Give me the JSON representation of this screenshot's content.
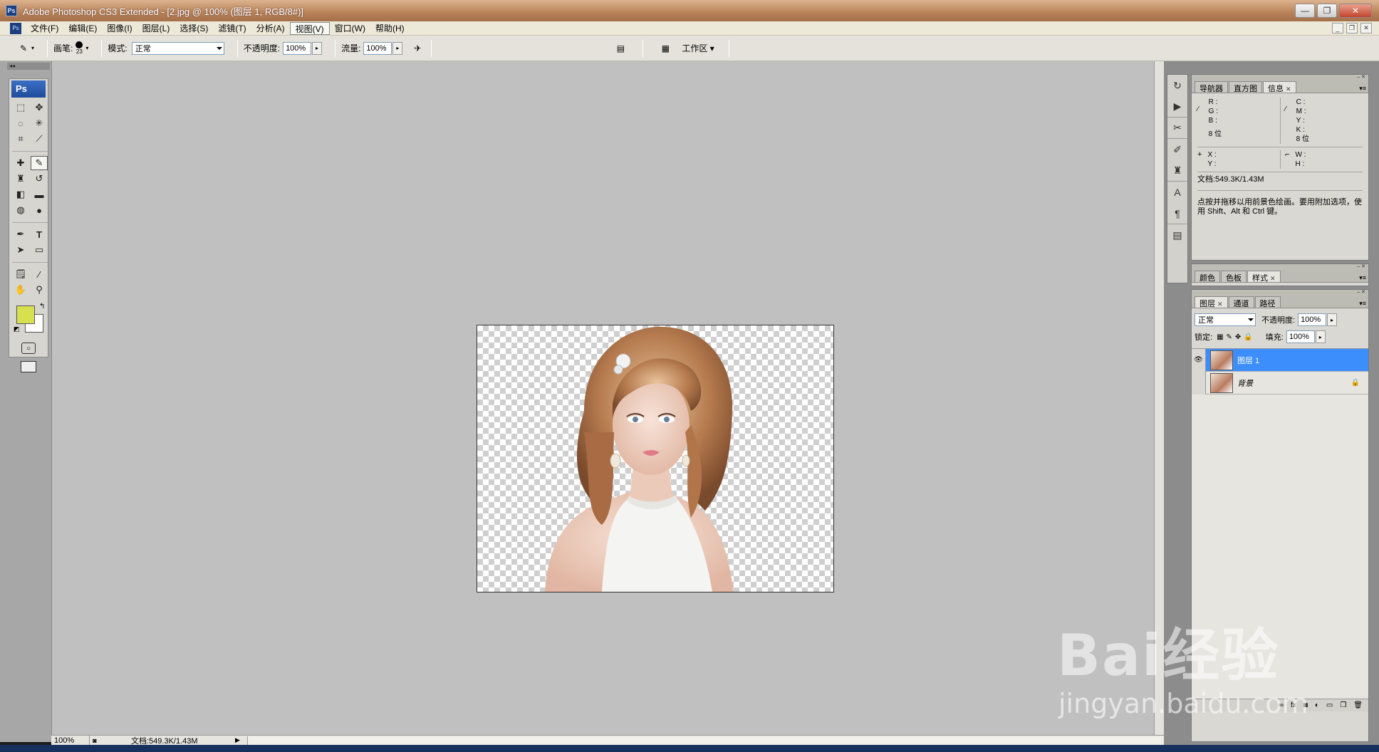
{
  "window": {
    "title": "Adobe Photoshop CS3 Extended - [2.jpg @ 100% (图层 1, RGB/8#)]"
  },
  "menu": [
    {
      "label": "文件(F)"
    },
    {
      "label": "编辑(E)"
    },
    {
      "label": "图像(I)"
    },
    {
      "label": "图层(L)"
    },
    {
      "label": "选择(S)"
    },
    {
      "label": "滤镜(T)"
    },
    {
      "label": "分析(A)"
    },
    {
      "label": "视图(V)"
    },
    {
      "label": "窗口(W)"
    },
    {
      "label": "帮助(H)"
    }
  ],
  "options": {
    "brush_label": "画笔:",
    "brush_size": "23",
    "mode_label": "模式:",
    "mode_value": "正常",
    "opacity_label": "不透明度:",
    "opacity_value": "100%",
    "flow_label": "流量:",
    "flow_value": "100%",
    "workspace_label": "工作区"
  },
  "toolbox": {
    "header": "Ps",
    "foreground_color": "#d8e050",
    "background_color": "#ffffff"
  },
  "status": {
    "zoom": "100%",
    "doc": "文档:549.3K/1.43M"
  },
  "info_panel": {
    "tabs": [
      {
        "label": "导航器"
      },
      {
        "label": "直方图"
      },
      {
        "label": "信息"
      }
    ],
    "left_labels": "R :\nG :\nB :",
    "right_labels": "C :\nM :\nY :\nK :",
    "bits_left": "8 位",
    "bits_right": "8 位",
    "xy_labels": "X :\nY :",
    "wh_labels": "W :\nH :",
    "doc": "文档:549.3K/1.43M",
    "hint": "点按并拖移以用前景色绘画。要用附加选项，使用 Shift、Alt 和 Ctrl 键。"
  },
  "color_panel": {
    "tabs": [
      {
        "label": "颜色"
      },
      {
        "label": "色板"
      },
      {
        "label": "样式"
      }
    ]
  },
  "layers_panel": {
    "tabs": [
      {
        "label": "图层"
      },
      {
        "label": "通道"
      },
      {
        "label": "路径"
      }
    ],
    "blend_mode": "正常",
    "opacity_label": "不透明度:",
    "opacity_value": "100%",
    "lock_label": "锁定:",
    "fill_label": "填充:",
    "fill_value": "100%",
    "layers": [
      {
        "name": "图层 1",
        "visible": true,
        "active": true
      },
      {
        "name": "背景",
        "visible": false,
        "active": false,
        "locked": true
      }
    ]
  },
  "watermark": {
    "brand": "Bai经验",
    "url": "jingyan.baidu.com"
  }
}
